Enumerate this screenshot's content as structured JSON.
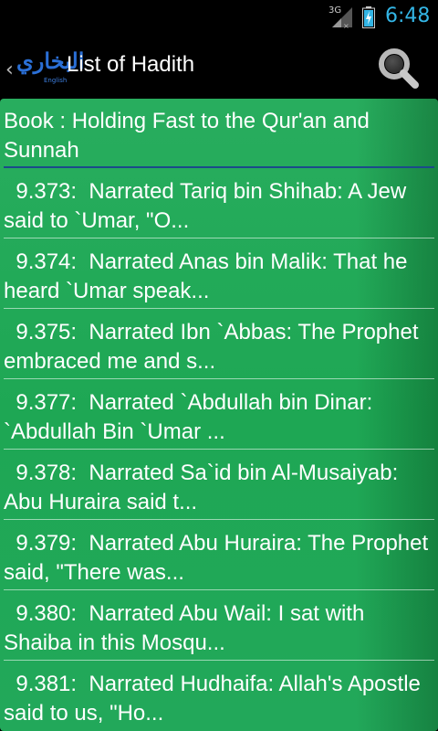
{
  "status_bar": {
    "network": "3G",
    "time": "6:48",
    "time_color": "#33b5e5"
  },
  "action_bar": {
    "logo_arabic": "البخاري",
    "logo_english": "English",
    "title": "List of Hadith",
    "up_icon": "chevron-left-icon",
    "search_icon": "magnifier-icon"
  },
  "list": {
    "background_color": "#1ea754",
    "book_header": "Book : Holding Fast to the Qur'an and Sunnah",
    "items": [
      {
        "text": "  9.373:  Narrated Tariq bin Shihab: A Jew said to `Umar, \"O..."
      },
      {
        "text": "  9.374:  Narrated Anas bin Malik: That he heard `Umar speak..."
      },
      {
        "text": "  9.375:  Narrated Ibn `Abbas: The Prophet embraced me and s..."
      },
      {
        "text": "  9.377:  Narrated `Abdullah bin Dinar: `Abdullah Bin `Umar ..."
      },
      {
        "text": "  9.378:  Narrated Sa`id bin Al-Musaiyab: Abu Huraira said t..."
      },
      {
        "text": "  9.379:  Narrated Abu Huraira: The Prophet said, \"There was..."
      },
      {
        "text": "  9.380:  Narrated Abu Wail: I sat with Shaiba in this Mosqu..."
      },
      {
        "text": "  9.381:  Narrated Hudhaifa: Allah's Apostle said to us, \"Ho..."
      }
    ]
  }
}
